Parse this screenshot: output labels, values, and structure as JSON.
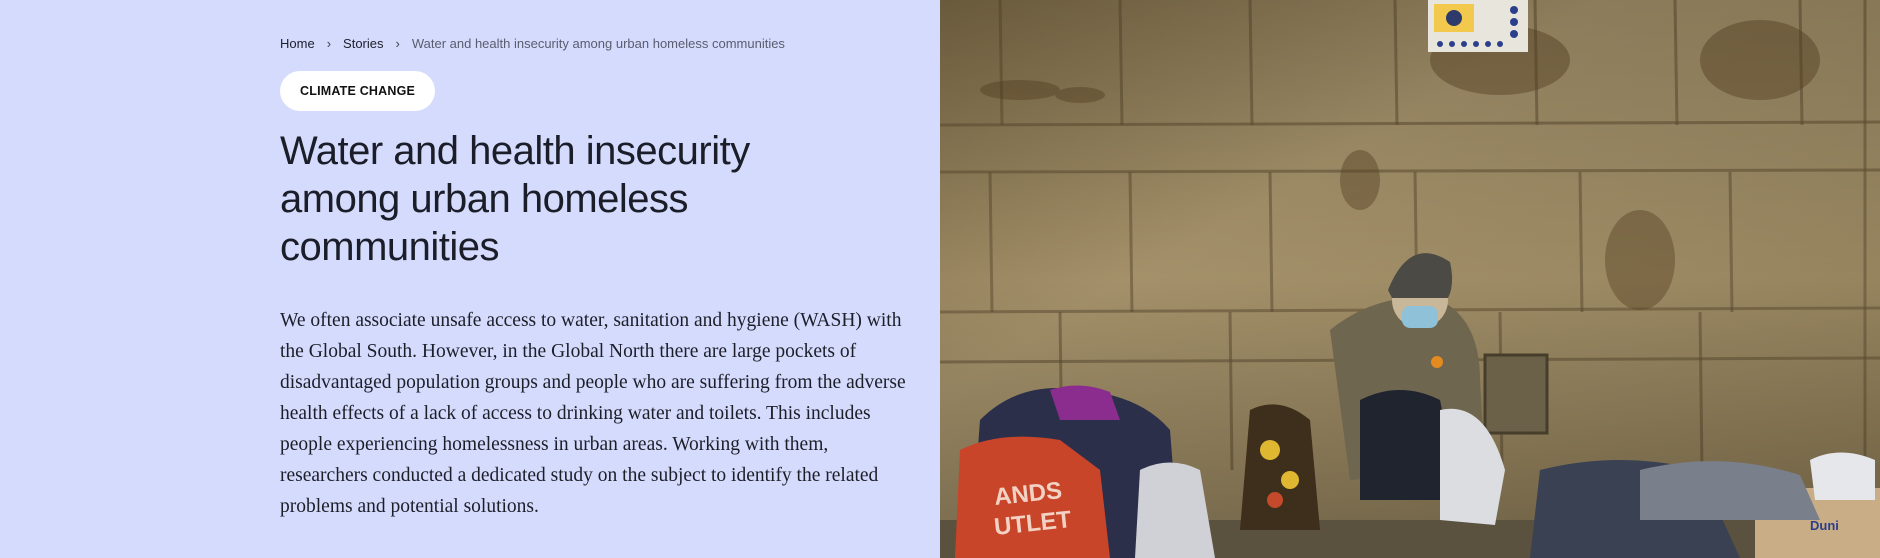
{
  "breadcrumb": {
    "home": "Home",
    "stories": "Stories",
    "current": "Water and health insecurity among urban homeless communities",
    "separator_icon": "chevron-right-icon"
  },
  "tag": {
    "label": "CLIMATE CHANGE"
  },
  "article": {
    "title": "Water and health insecurity among urban homeless communities",
    "lead": "We often associate unsafe access to water, sanitation and hygiene (WASH) with the Global South. However, in the Global North there are large pockets of disadvantaged population groups and people who are suffering from the adverse health effects of a lack of access to drinking water and toilets. This includes people experiencing homelessness in urban areas. Working with them, researchers conducted a dedicated study on the subject to identify the related problems and potential solutions."
  },
  "hero_image": {
    "bag_text_line1": "ANDS",
    "bag_text_line2": "UTLET",
    "box_label": "Duni"
  },
  "colors": {
    "panel_bg": "#d5dbfd",
    "tag_bg": "#ffffff",
    "text": "#1b1e29",
    "muted": "#5a5d6e"
  }
}
